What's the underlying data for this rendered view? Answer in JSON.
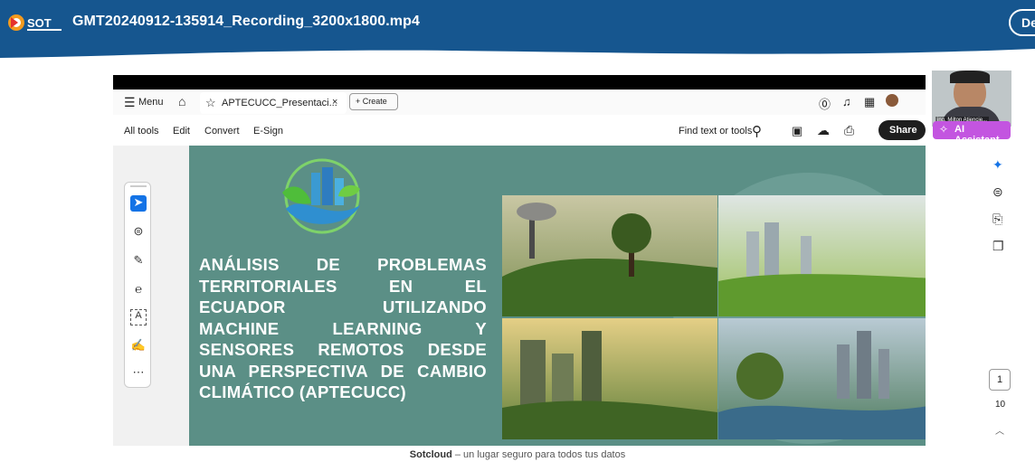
{
  "header": {
    "logo_text": "SOT",
    "title": "GMT20240912-135914_Recording_3200x1800.mp4",
    "download_label": "De"
  },
  "viewer": {
    "menu_label": "Menu",
    "tab_label": "APTECUCC_Presentaci...",
    "tab_close": "×",
    "create_label": "+ Create",
    "toolbar": {
      "all_tools": "All tools",
      "edit": "Edit",
      "convert": "Convert",
      "esign": "E-Sign",
      "find": "Find text or tools",
      "share": "Share"
    },
    "ai_assistant": "AI Assistant",
    "webcam_name": "ing. Milton Atiencie...",
    "page_current": "1",
    "page_total": "10"
  },
  "slide": {
    "title_lines": [
      "ANÁLISIS DE PROBLEMAS",
      "TERRITORIALES EN EL",
      "ECUADOR UTILIZANDO",
      "MACHINE LEARNING Y",
      "SENSORES REMOTOS DESDE",
      "UNA PERSPECTIVA DE CAMBIO",
      "CLIMÁTICO (APTECUCC)"
    ],
    "colors": {
      "bg": "#5b8f86",
      "text": "#ffffff"
    }
  },
  "footer": {
    "brand": "Sotcloud",
    "tagline": " – un lugar seguro para todos tus datos"
  },
  "icons": [
    "menu-icon",
    "home-icon",
    "star-icon",
    "help-icon",
    "bell-icon",
    "apps-icon",
    "search-icon",
    "save-icon",
    "upload-icon",
    "print-icon",
    "select-tool-icon",
    "comment-tool-icon",
    "pen-tool-icon",
    "lasso-tool-icon",
    "text-box-tool-icon",
    "signature-tool-icon",
    "more-tools-icon",
    "ai-panel-icon",
    "comments-panel-icon",
    "bookmark-panel-icon",
    "pages-panel-icon"
  ]
}
